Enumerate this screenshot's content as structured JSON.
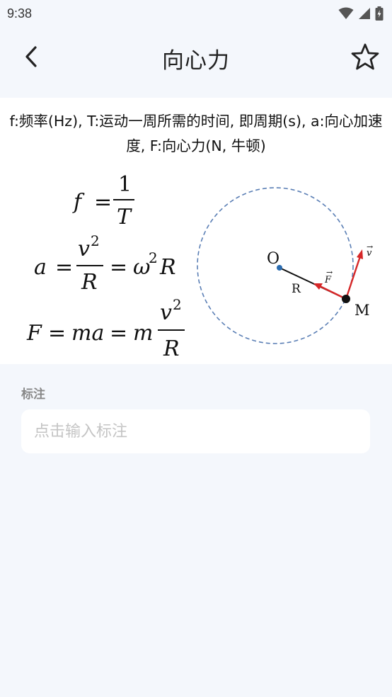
{
  "status": {
    "time": "9:38",
    "icons": [
      "wifi-icon",
      "signal-icon",
      "battery-charging-icon"
    ]
  },
  "header": {
    "title": "向心力",
    "back_icon": "chevron-left-icon",
    "favorite_icon": "star-outline-icon"
  },
  "content": {
    "description": "f:频率(Hz), T:运动一周所需的时间, 即周期(s), a:向心加速度, F:向心力(N, 牛顿)",
    "formulas": {
      "f_eq": "f = 1/T",
      "a_eq": "a = v²/R = ω²R",
      "F_eq": "F = ma = m v²/R"
    },
    "diagram": {
      "center_label": "O",
      "radius_label": "R",
      "point_label": "M",
      "force_label": "F",
      "velocity_label": "v",
      "circle_color": "#5b7fb5",
      "vector_color": "#d62728"
    }
  },
  "note": {
    "label": "标注",
    "placeholder": "点击输入标注",
    "value": ""
  }
}
